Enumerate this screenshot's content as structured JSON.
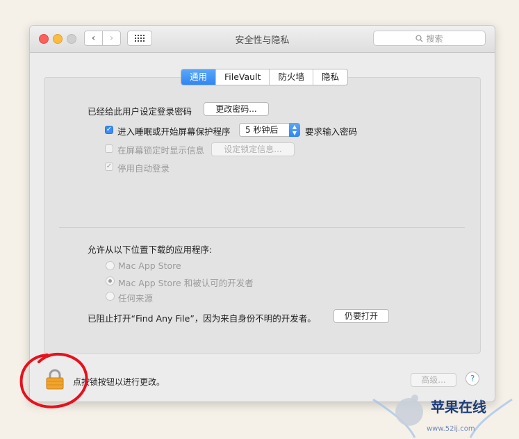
{
  "window": {
    "title": "安全性与隐私",
    "search_placeholder": "搜索"
  },
  "tabs": [
    {
      "label": "通用",
      "active": true
    },
    {
      "label": "FileVault",
      "active": false
    },
    {
      "label": "防火墙",
      "active": false
    },
    {
      "label": "隐私",
      "active": false
    }
  ],
  "general": {
    "password_label": "已经给此用户设定登录密码",
    "change_password_button": "更改密码...",
    "require_password": {
      "checked": true,
      "prefix": "进入睡眠或开始屏幕保护程序",
      "delay": "5 秒钟后",
      "suffix": "要求输入密码"
    },
    "show_message": {
      "checked": false,
      "label": "在屏幕锁定时显示信息",
      "button": "设定锁定信息..."
    },
    "disable_autologin": {
      "checked": true,
      "label": "停用自动登录"
    }
  },
  "downloads": {
    "heading": "允许从以下位置下载的应用程序:",
    "options": [
      {
        "label": "Mac App Store",
        "selected": false
      },
      {
        "label": "Mac App Store 和被认可的开发者",
        "selected": true
      },
      {
        "label": "任何来源",
        "selected": false
      }
    ],
    "blocked_message": "已阻止打开“Find Any File”，因为来自身份不明的开发者。",
    "open_anyway_button": "仍要打开"
  },
  "footer": {
    "lock_message": "点按锁按钮以进行更改。",
    "advanced_button": "高级...",
    "help_label": "?"
  },
  "watermark": {
    "title": "苹果在线",
    "url": "www.52ij.com"
  },
  "colors": {
    "accent": "#2f86f2",
    "annotation": "#e8101c"
  }
}
